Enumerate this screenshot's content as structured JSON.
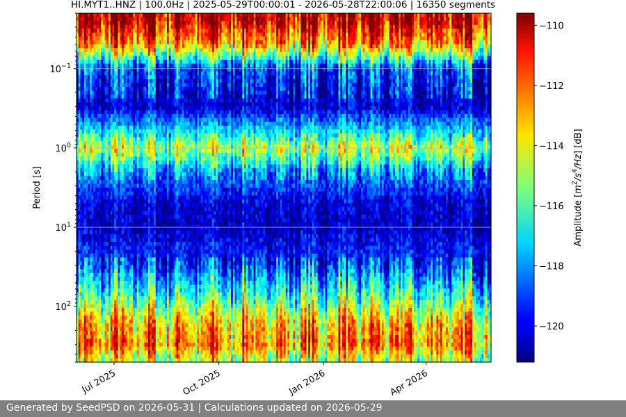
{
  "chart_data": {
    "type": "heatmap",
    "title": "HI.MYT1..HNZ | 100.0Hz | 2025-05-29T00:00:01 - 2026-05-28T22:00:06 | 16350 segments",
    "xlabel": "",
    "ylabel": "Period [s]",
    "x_range": [
      "2025-05-29",
      "2026-05-28"
    ],
    "x_ticks": [
      {
        "date": "2025-07-01",
        "label": "Jul 2025"
      },
      {
        "date": "2025-10-01",
        "label": "Oct 2025"
      },
      {
        "date": "2026-01-01",
        "label": "Jan 2026"
      },
      {
        "date": "2026-04-01",
        "label": "Apr 2026"
      }
    ],
    "y_scale": "log",
    "y_inverted": true,
    "y_range": [
      0.02,
      500
    ],
    "y_ticks": [
      {
        "value": 0.1,
        "base": "10",
        "exp": "−1"
      },
      {
        "value": 1,
        "base": "10",
        "exp": "0"
      },
      {
        "value": 10,
        "base": "10",
        "exp": "1"
      },
      {
        "value": 100,
        "base": "10",
        "exp": "2"
      }
    ],
    "grid": true,
    "colormap": "jet",
    "colorbar": {
      "label_parts": [
        "Amplitude [",
        "m",
        "2",
        "/s",
        "4",
        "/Hz",
        "] [dB]"
      ],
      "range": [
        -121.2,
        -109.6
      ],
      "ticks": [
        {
          "value": -110,
          "label": "−110"
        },
        {
          "value": -112,
          "label": "−112"
        },
        {
          "value": -114,
          "label": "−114"
        },
        {
          "value": -116,
          "label": "−116"
        },
        {
          "value": -118,
          "label": "−118"
        },
        {
          "value": -120,
          "label": "−120"
        }
      ]
    },
    "period_profile": [
      {
        "period": 0.025,
        "amplitude_db": -110.5
      },
      {
        "period": 0.05,
        "amplitude_db": -113
      },
      {
        "period": 0.1,
        "amplitude_db": -119
      },
      {
        "period": 0.3,
        "amplitude_db": -120.3
      },
      {
        "period": 0.7,
        "amplitude_db": -116.5
      },
      {
        "period": 1,
        "amplitude_db": -114.5
      },
      {
        "period": 2,
        "amplitude_db": -118
      },
      {
        "period": 5,
        "amplitude_db": -120.2
      },
      {
        "period": 10,
        "amplitude_db": -120.5
      },
      {
        "period": 30,
        "amplitude_db": -119
      },
      {
        "period": 80,
        "amplitude_db": -116
      },
      {
        "period": 150,
        "amplitude_db": -113.5
      },
      {
        "period": 300,
        "amplitude_db": -112.5
      },
      {
        "period": 500,
        "amplitude_db": -115
      }
    ]
  },
  "footer": {
    "text": "Generated by SeedPSD on 2026-05-31 | Calculations updated on 2026-05-29",
    "background": "#808080"
  }
}
